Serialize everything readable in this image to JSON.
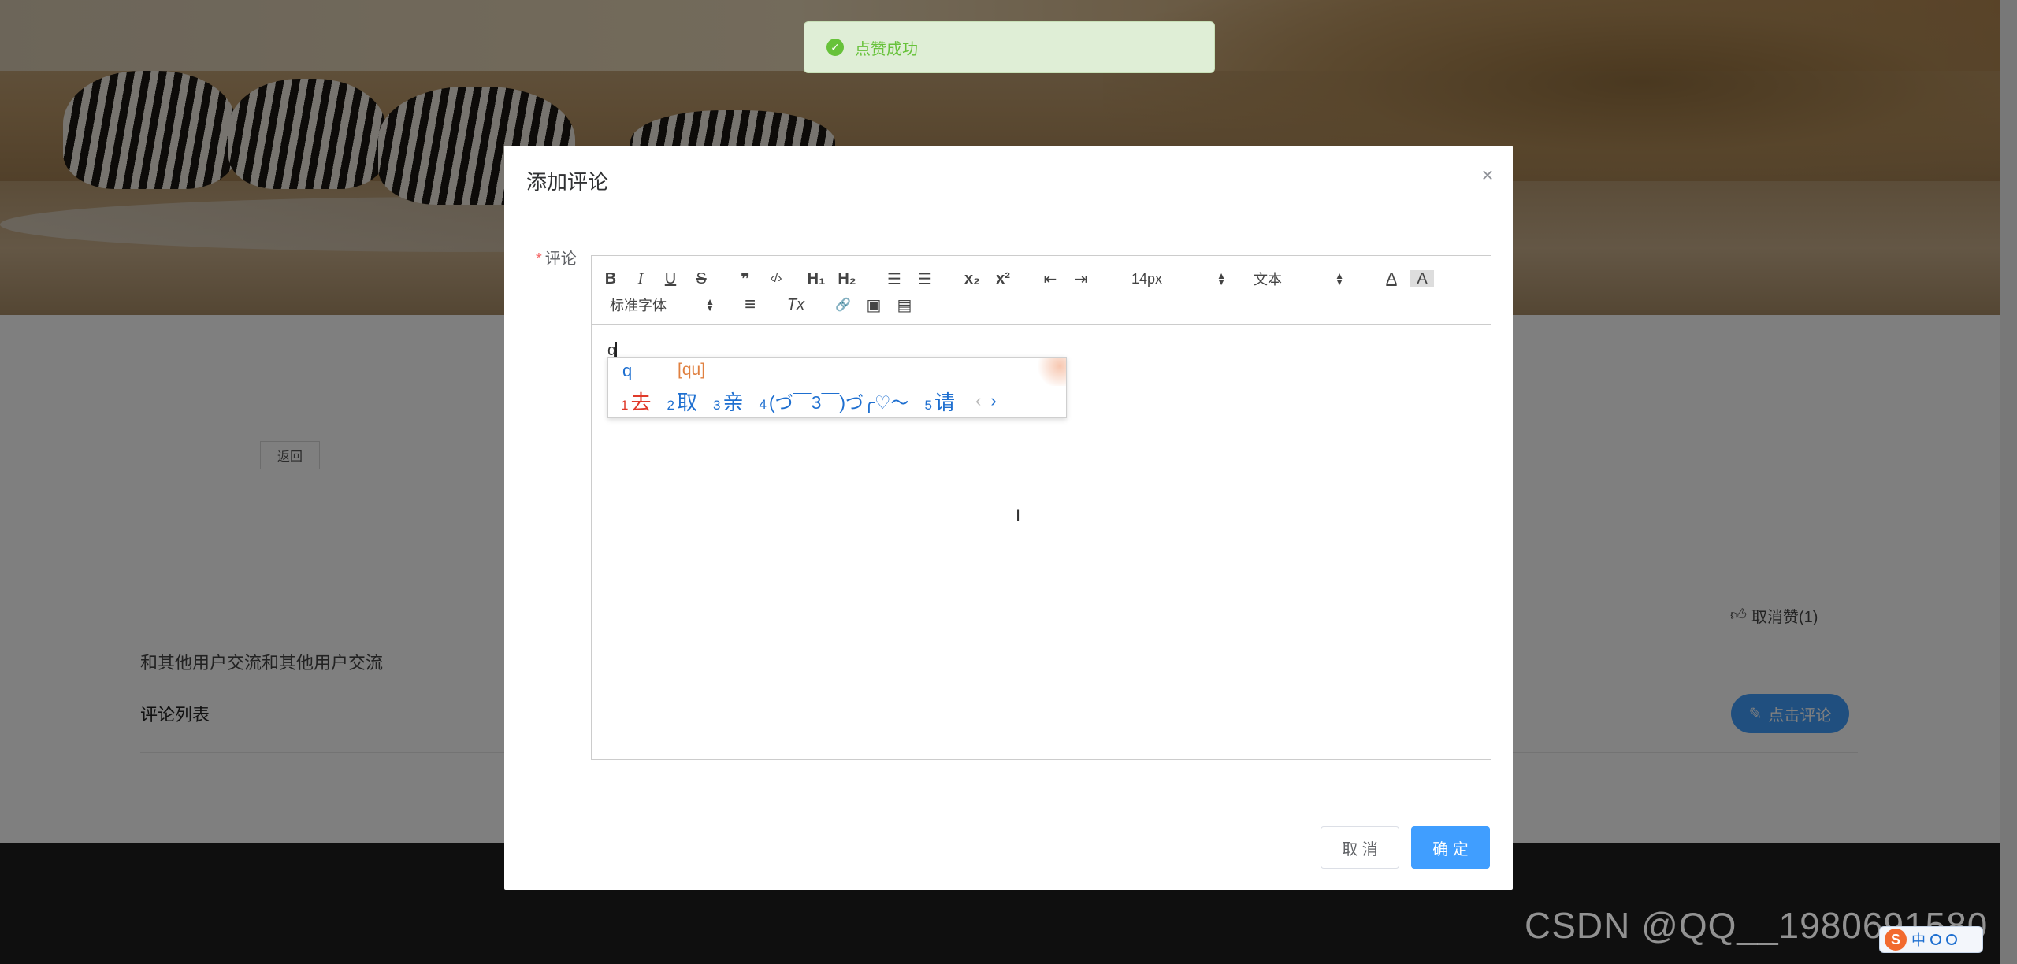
{
  "toast": {
    "text": "点赞成功",
    "icon": "check-circle-icon",
    "color": "#67c23a"
  },
  "page": {
    "back_label": "返回",
    "like_label": "取消赞(1)",
    "description": "和其他用户交流和其他用户交流",
    "comment_list_title": "评论列表",
    "comment_button_label": "点击评论"
  },
  "dialog": {
    "title": "添加评论",
    "close_glyph": "×",
    "field_label": "评论",
    "required_mark": "*",
    "toolbar": {
      "bold": "B",
      "italic": "I",
      "underline": "U",
      "strike": "S",
      "quote": "❞",
      "code": "‹/›",
      "h1": "H₁",
      "h2": "H₂",
      "ordered_list": "☰",
      "bullet_list": "☰",
      "subscript": "x₂",
      "superscript": "x²",
      "outdent": "⇤",
      "indent": "⇥",
      "size_value": "14px",
      "header_value": "文本",
      "font_color": "A",
      "background_color": "A",
      "font_value": "标准字体",
      "align": "≡",
      "clean": "Tx",
      "link": "🔗",
      "image": "▣",
      "video": "▤"
    },
    "content": "q",
    "cancel_label": "取 消",
    "confirm_label": "确 定"
  },
  "ime": {
    "input": "q",
    "pinyin": "[qu]",
    "candidates": [
      {
        "num": "1",
        "text": "去"
      },
      {
        "num": "2",
        "text": "取"
      },
      {
        "num": "3",
        "text": "亲"
      },
      {
        "num": "4",
        "text": "(づ￣3￣)づ╭♡～"
      },
      {
        "num": "5",
        "text": "请"
      }
    ],
    "prev": "‹",
    "next": "›"
  },
  "tray": {
    "mode": "中"
  },
  "watermark": "CSDN @QQ__1980691580",
  "colors": {
    "primary": "#409eff",
    "success": "#67c23a",
    "danger": "#f56c6c",
    "footer": "#1e1e1e"
  }
}
